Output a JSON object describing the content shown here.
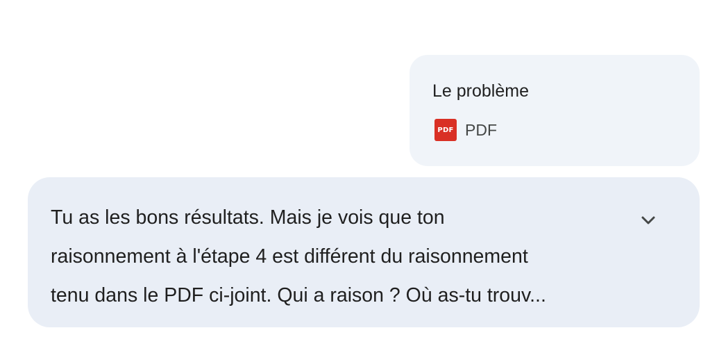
{
  "attachment": {
    "title": "Le problème",
    "icon_name": "pdf-file-icon",
    "icon_text": "PDF",
    "icon_color": "#d93025",
    "type_label": "PDF"
  },
  "message": {
    "lines": [
      "Tu as les bons résultats. Mais je vois que ton",
      "raisonnement à l'étape 4 est différent du raisonnement",
      "tenu dans le PDF ci-joint. Qui a raison ? Où as-tu trouv..."
    ],
    "expand_icon": "chevron-down-icon"
  },
  "colors": {
    "attachment_bg": "#f0f4f9",
    "bubble_bg": "#e9eef6",
    "text": "#1f1f1f"
  }
}
